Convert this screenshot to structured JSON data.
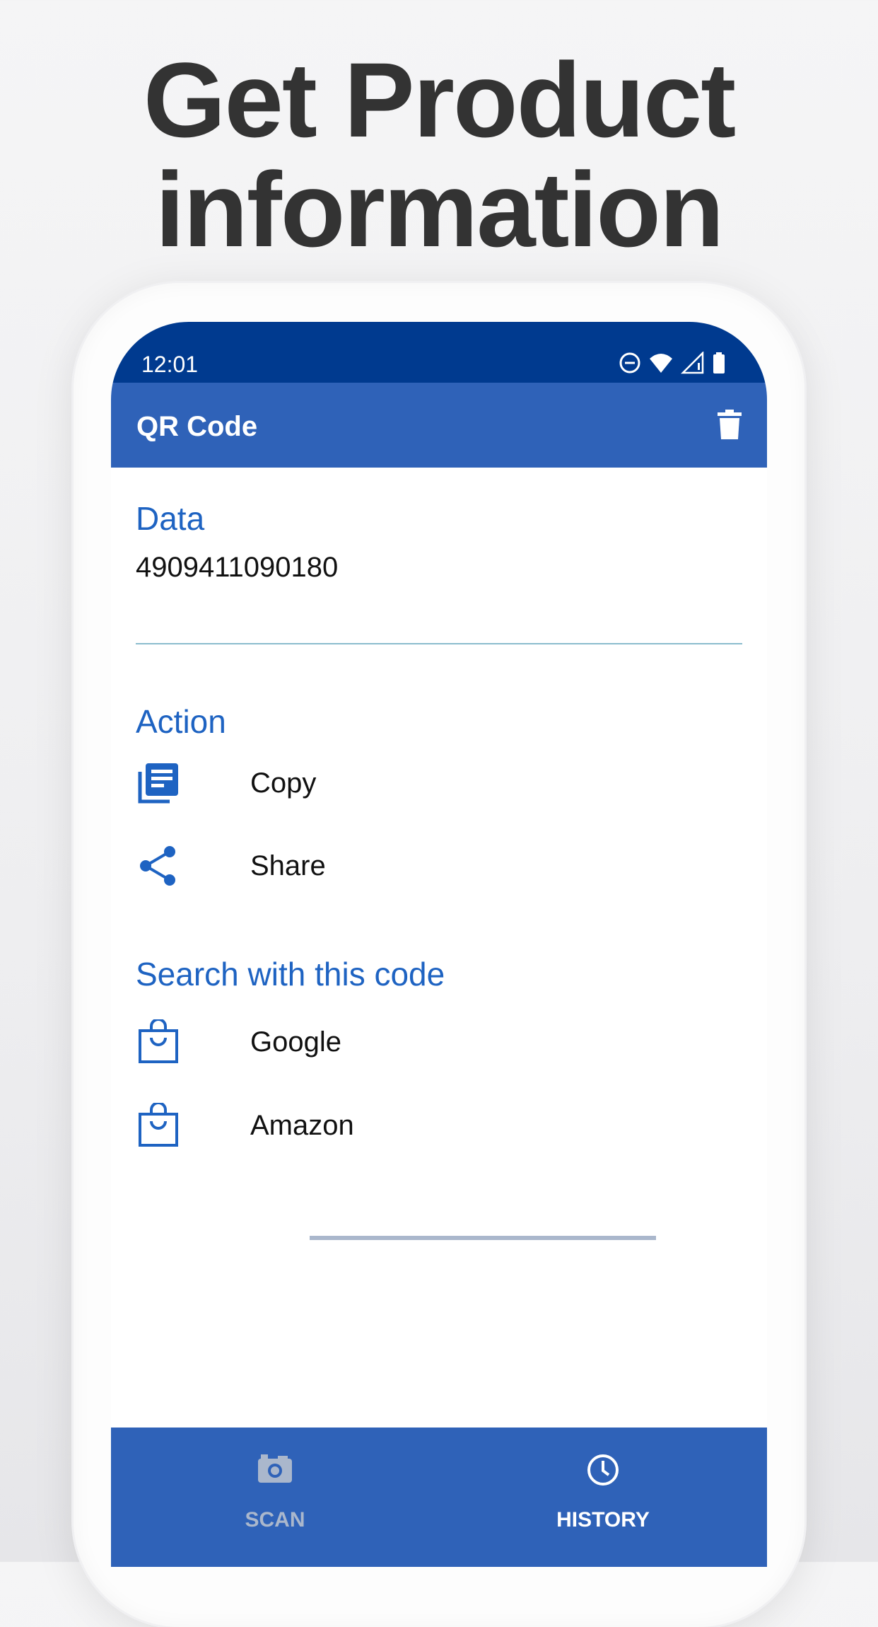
{
  "headline": {
    "line1": "Get Product",
    "line2": "information"
  },
  "status_bar": {
    "time": "12:01",
    "icons": [
      "do-not-disturb-icon",
      "wifi-icon",
      "signal-icon",
      "battery-icon"
    ]
  },
  "app_bar": {
    "title": "QR Code",
    "action_icon": "delete-icon"
  },
  "data_section": {
    "title": "Data",
    "value": "4909411090180"
  },
  "action_section": {
    "title": "Action",
    "items": [
      {
        "label": "Copy",
        "icon": "copy-icon"
      },
      {
        "label": "Share",
        "icon": "share-icon"
      }
    ]
  },
  "search_section": {
    "title": "Search with this code",
    "items": [
      {
        "label": "Google",
        "icon": "shopping-bag-icon"
      },
      {
        "label": "Amazon",
        "icon": "shopping-bag-icon"
      }
    ]
  },
  "bottom_nav": {
    "items": [
      {
        "label": "SCAN",
        "icon": "camera-icon",
        "active": false
      },
      {
        "label": "HISTORY",
        "icon": "history-icon",
        "active": true
      }
    ]
  },
  "colors": {
    "status_bar": "#003a8f",
    "app_bar": "#2f62b8",
    "section_title": "#1e63c2",
    "headline": "#333333"
  }
}
